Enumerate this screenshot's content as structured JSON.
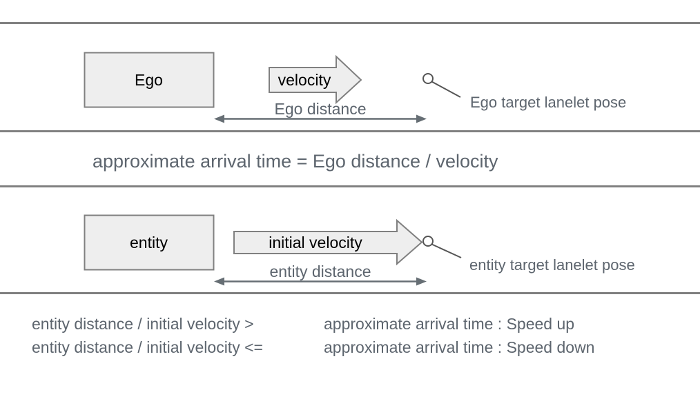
{
  "diagram": {
    "title_text": "approximate arrival time = Ego distance / velocity",
    "colors": {
      "divider": "#808080",
      "box_fill": "#eeeeee",
      "box_stroke": "#808080",
      "arrow_fill": "#eeeeee",
      "arrow_stroke": "#808080",
      "dimension_stroke": "#666e74",
      "pose_stroke": "#555555",
      "label_gray": "#5d656e",
      "label_black": "#000000"
    },
    "ego_row": {
      "box_label": "Ego",
      "velocity_arrow_label": "velocity",
      "distance_label": "Ego distance",
      "pose_label": "Ego target lanelet pose",
      "pose_marker": "circle-marker-icon"
    },
    "formula_row": {
      "text": "approximate arrival time = Ego distance / velocity"
    },
    "entity_row": {
      "box_label": "entity",
      "velocity_arrow_label": "initial velocity",
      "distance_label": "entity distance",
      "pose_label": "entity target lanelet pose",
      "pose_marker": "circle-marker-icon"
    },
    "conditions": [
      {
        "expression": "entity distance / initial velocity >",
        "result": "approximate arrival time : Speed up"
      },
      {
        "expression": "entity distance / initial velocity <=",
        "result": "approximate arrival time : Speed down"
      }
    ]
  }
}
